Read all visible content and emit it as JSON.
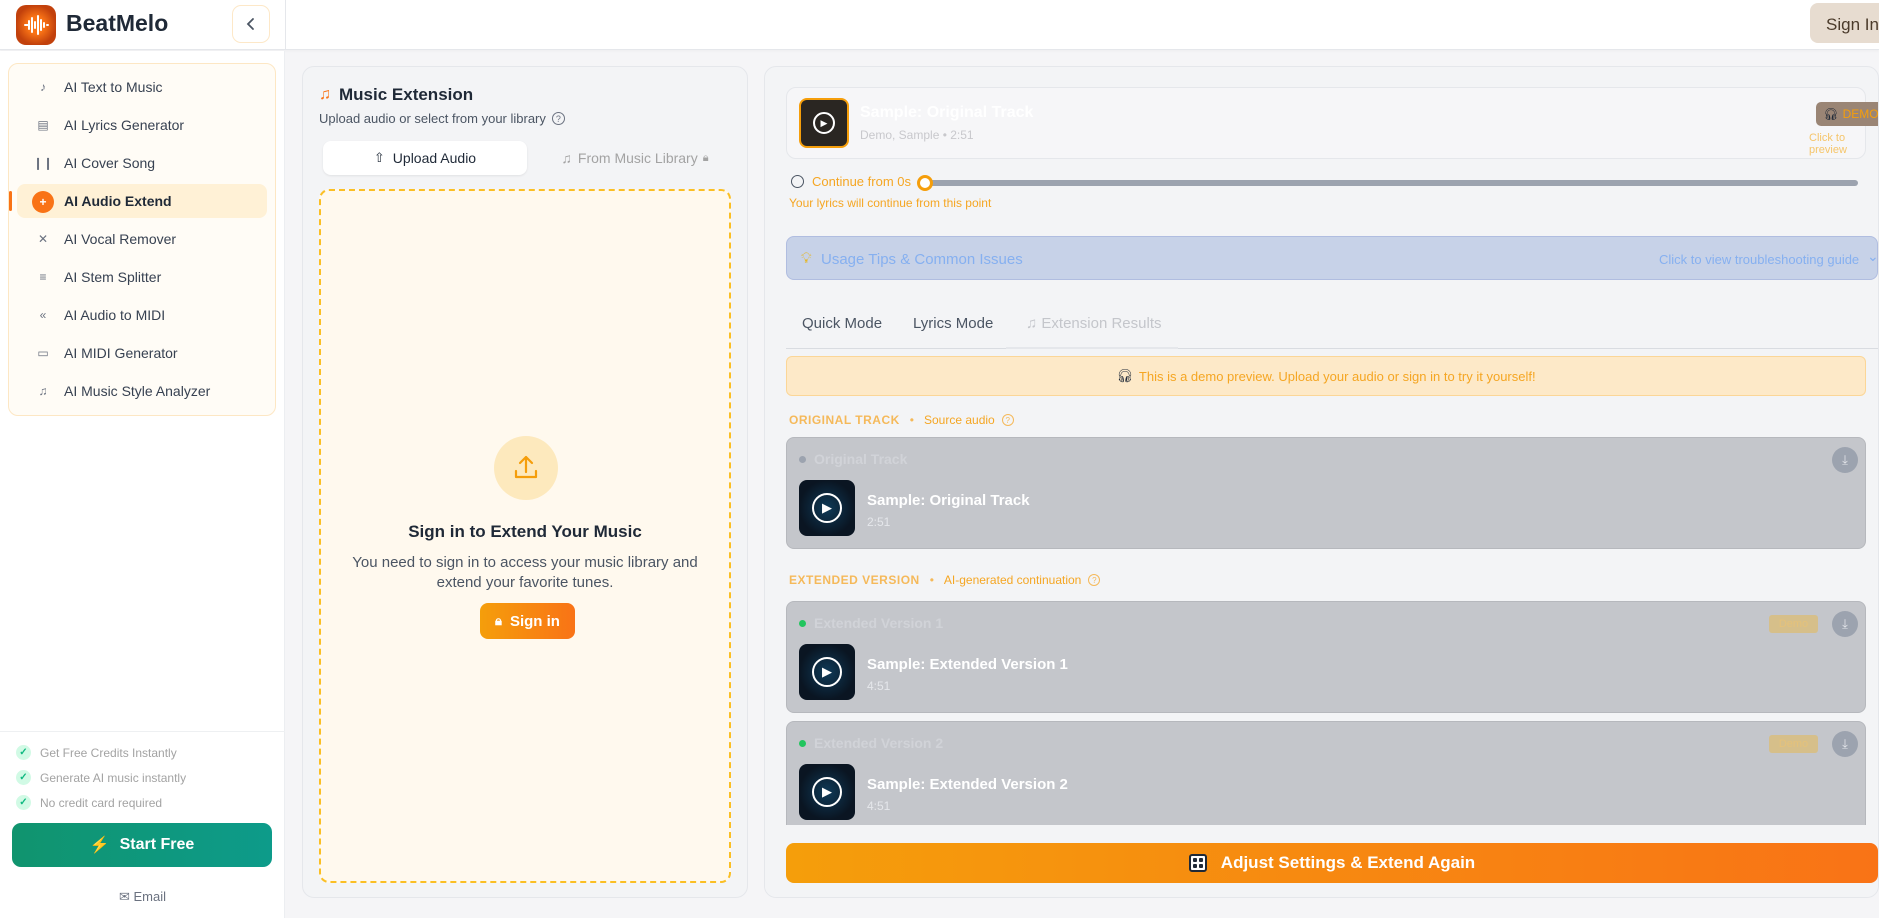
{
  "header": {
    "brand": "BeatMelo",
    "signin_label": "Sign In"
  },
  "sidebar": {
    "items": [
      {
        "label": "AI Text to Music",
        "icon": "text-music-icon"
      },
      {
        "label": "AI Lyrics Generator",
        "icon": "lyrics-icon"
      },
      {
        "label": "AI Cover Song",
        "icon": "cover-icon"
      },
      {
        "label": "AI Audio Extend",
        "icon": "extend-icon",
        "active": true
      },
      {
        "label": "AI Vocal Remover",
        "icon": "vocal-remover-icon"
      },
      {
        "label": "AI Stem Splitter",
        "icon": "stem-icon"
      },
      {
        "label": "AI Audio to MIDI",
        "icon": "midi-convert-icon"
      },
      {
        "label": "AI MIDI Generator",
        "icon": "midi-icon"
      },
      {
        "label": "AI Music Style Analyzer",
        "icon": "analyzer-icon"
      }
    ],
    "features": [
      "Get Free Credits Instantly",
      "Generate AI music instantly",
      "No credit card required"
    ],
    "start_free": "Start Free",
    "email": "Email"
  },
  "left_panel": {
    "title": "Music Extension",
    "subtitle": "Upload audio or select from your library",
    "tab_upload": "Upload Audio",
    "tab_library": "From Music Library",
    "dz_title": "Sign in to Extend Your Music",
    "dz_text": "You need to sign in to access your music library and extend your favorite tunes.",
    "dz_signin": "Sign in"
  },
  "right_panel": {
    "track": {
      "name": "Sample: Original Track",
      "meta": "Demo, Sample  •  2:51",
      "badge": "DEMO",
      "hint": "Click to preview"
    },
    "continue_label": "Continue from 0s",
    "slider_value_s": 0,
    "lyrics_note": "Your lyrics will continue from this point",
    "tips_title": "Usage Tips & Common Issues",
    "tips_link": "Click to view troubleshooting guide",
    "tabs": [
      "Quick Mode",
      "Lyrics Mode",
      "Extension Results"
    ],
    "demo_banner": "This is a demo preview. Upload your audio or sign in to try it yourself!",
    "original_section": {
      "title": "ORIGINAL TRACK",
      "sub": "Source audio"
    },
    "extended_section": {
      "title": "EXTENDED VERSION",
      "sub": "AI-generated continuation"
    },
    "original_track": {
      "header": "Original Track",
      "name": "Sample: Original Track",
      "duration": "2:51"
    },
    "extended_tracks": [
      {
        "header": "Extended Version 1",
        "tag": "Demo",
        "name": "Sample: Extended Version 1",
        "duration": "4:51"
      },
      {
        "header": "Extended Version 2",
        "tag": "Demo",
        "name": "Sample: Extended Version 2",
        "duration": "4:51"
      }
    ],
    "adjust_button": "Adjust Settings & Extend Again"
  },
  "colors": {
    "accent": "#f97316",
    "accent_light": "#f59e0b",
    "green": "#10946e"
  }
}
